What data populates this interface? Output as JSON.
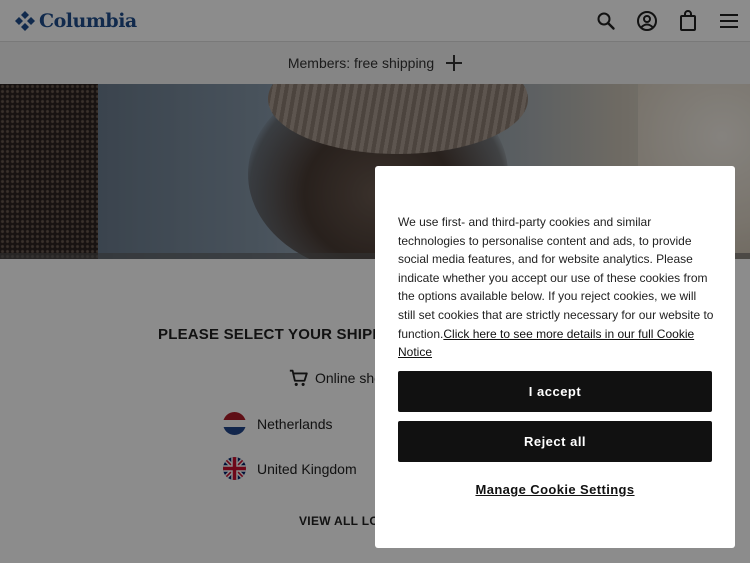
{
  "header": {
    "brand": "Columbia",
    "brand_color": "#1f4e8c",
    "icons": [
      "search-icon",
      "account-icon",
      "bag-icon",
      "menu-icon"
    ]
  },
  "promo": {
    "text": "Members: free shipping",
    "icon": "plus-icon"
  },
  "locator": {
    "title": "PLEASE SELECT YOUR SHIPPIN",
    "online_label": "Online sho",
    "countries": [
      {
        "name": "Netherlands",
        "flag": "netherlands-flag"
      },
      {
        "name": "United Kingdom",
        "flag": "uk-flag"
      }
    ],
    "view_all": "VIEW ALL LO"
  },
  "cookie_dialog": {
    "body": "We use first- and third-party cookies and similar technologies to personalise content and ads, to provide social media features, and for website analytics. Please indicate whether you accept our use of these cookies from the options available below. If you reject cookies, we will still set cookies that are strictly necessary for our website to function.",
    "link": "Click here to see more details in our full Cookie Notice",
    "accept_label": "I accept",
    "reject_label": "Reject all",
    "manage_label": "Manage Cookie Settings"
  }
}
